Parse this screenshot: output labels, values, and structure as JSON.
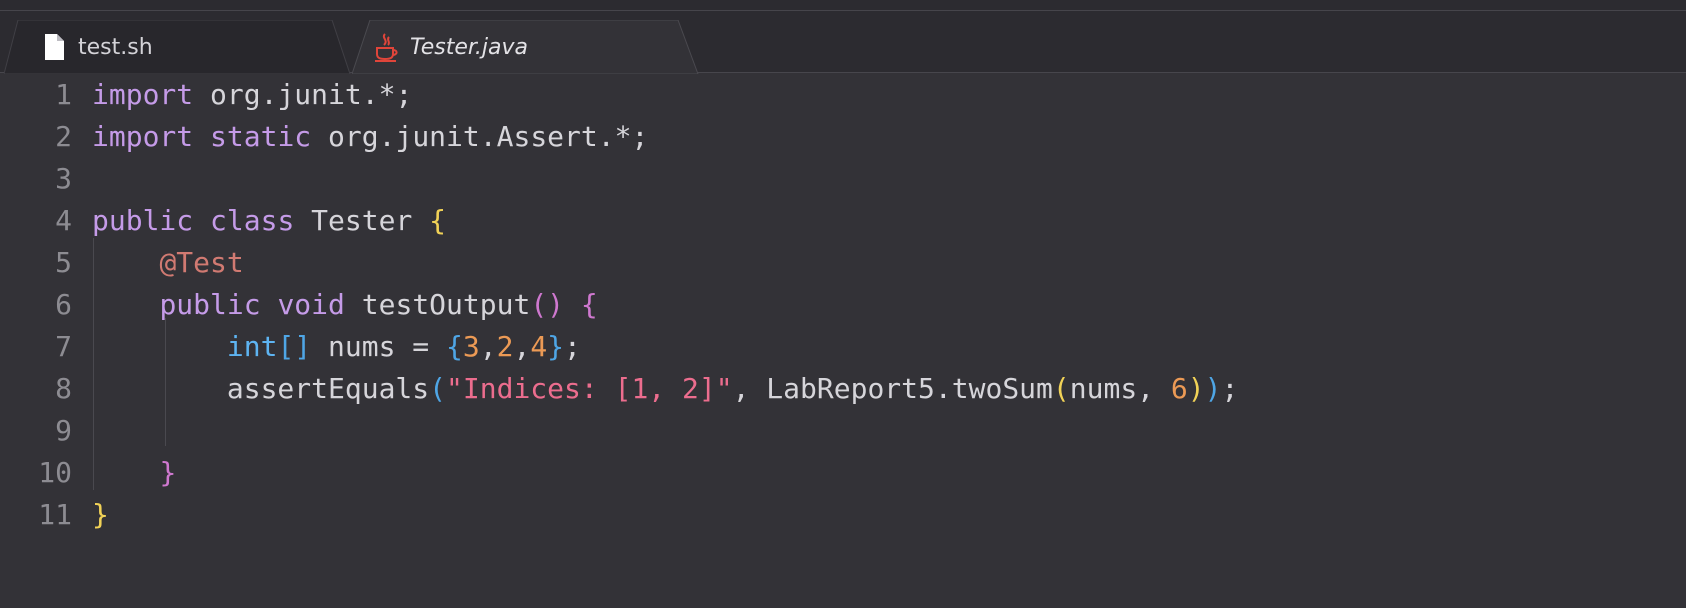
{
  "tabs": [
    {
      "label": "test.sh",
      "icon": "file-icon",
      "active": false
    },
    {
      "label": "Tester.java",
      "icon": "java-icon",
      "active": true
    }
  ],
  "colors": {
    "background": "#333237",
    "tabbar": "#2c2b30",
    "keyword": "#c59be8",
    "annotation": "#d17a72",
    "number": "#ec9a55",
    "string": "#ec6d8e",
    "bracket_yellow": "#f1d257",
    "bracket_magenta": "#cf78cf",
    "bracket_blue": "#4fa6e6"
  },
  "editor": {
    "line_numbers": [
      "1",
      "2",
      "3",
      "4",
      "5",
      "6",
      "7",
      "8",
      "9",
      "10",
      "11"
    ],
    "lines": [
      {
        "tokens": [
          [
            "kw",
            "import"
          ],
          [
            "pl",
            " org.junit.*;"
          ]
        ]
      },
      {
        "tokens": [
          [
            "kw",
            "import"
          ],
          [
            "pl",
            " "
          ],
          [
            "kw",
            "static"
          ],
          [
            "pl",
            " org.junit.Assert.*;"
          ]
        ]
      },
      {
        "tokens": []
      },
      {
        "tokens": [
          [
            "kw",
            "public"
          ],
          [
            "pl",
            " "
          ],
          [
            "kw",
            "class"
          ],
          [
            "pl",
            " Tester "
          ],
          [
            "br1",
            "{"
          ]
        ]
      },
      {
        "tokens": [
          [
            "pl",
            "    "
          ],
          [
            "an",
            "@Test"
          ]
        ]
      },
      {
        "tokens": [
          [
            "pl",
            "    "
          ],
          [
            "kw",
            "public"
          ],
          [
            "pl",
            " "
          ],
          [
            "kw",
            "void"
          ],
          [
            "pl",
            " testOutput"
          ],
          [
            "br2",
            "()"
          ],
          [
            "pl",
            " "
          ],
          [
            "br2",
            "{"
          ]
        ]
      },
      {
        "tokens": [
          [
            "pl",
            "        "
          ],
          [
            "ty",
            "int"
          ],
          [
            "br3",
            "[]"
          ],
          [
            "pl",
            " nums = "
          ],
          [
            "br3",
            "{"
          ],
          [
            "nm",
            "3"
          ],
          [
            "pl",
            ","
          ],
          [
            "nm",
            "2"
          ],
          [
            "pl",
            ","
          ],
          [
            "nm",
            "4"
          ],
          [
            "br3",
            "}"
          ],
          [
            "pl",
            ";"
          ]
        ]
      },
      {
        "tokens": [
          [
            "pl",
            "        assertEquals"
          ],
          [
            "br3",
            "("
          ],
          [
            "st",
            "\"Indices: [1, 2]\""
          ],
          [
            "pl",
            ", LabReport5.twoSum"
          ],
          [
            "br1",
            "("
          ],
          [
            "pl",
            "nums, "
          ],
          [
            "nm",
            "6"
          ],
          [
            "br1",
            ")"
          ],
          [
            "br3",
            ")"
          ],
          [
            "pl",
            ";"
          ]
        ]
      },
      {
        "tokens": []
      },
      {
        "tokens": [
          [
            "pl",
            "    "
          ],
          [
            "br2",
            "}"
          ]
        ]
      },
      {
        "tokens": [
          [
            "br1",
            "}"
          ]
        ]
      }
    ]
  }
}
